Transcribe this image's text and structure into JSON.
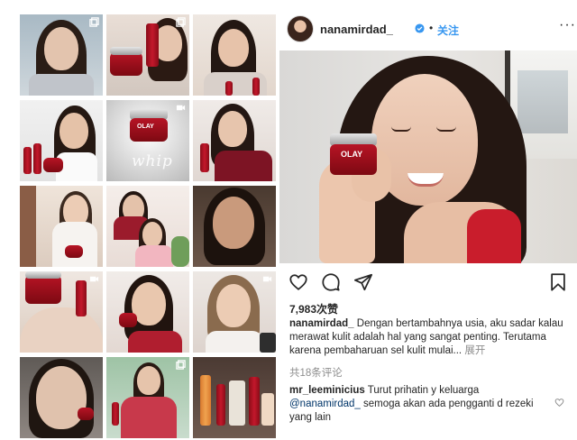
{
  "profile": {
    "username": "nanamirdad_",
    "separator": "•",
    "follow_label": "关注",
    "more_label": "···"
  },
  "post": {
    "likes": "7,983次赞",
    "caption_user": "nanamirdad_",
    "caption_text": " Dengan bertambahnya usia, aku sadar kalau merawat kulit adalah hal yang sangat penting. Terutama karena pembaharuan sel kulit mulai...",
    "caption_more": " 展开",
    "comments_count": "共18条评论",
    "comment": {
      "user": "mr_leeminicius",
      "text_1": " Turut prihatin y keluarga ",
      "mention": "@nanamirdad_",
      "text_2": " semoga akan ada pengganti d rezeki yang lain"
    }
  },
  "grid": {
    "whip_caption": "whip",
    "olay_label": "OLAY"
  },
  "colors": {
    "accent_blue": "#3897f0",
    "olay_red": "#b71425",
    "text": "#262626",
    "muted": "#8e8e8e"
  },
  "icons": [
    "heart-icon",
    "comment-icon",
    "share-icon",
    "bookmark-icon",
    "verified-icon",
    "carousel-icon",
    "video-icon"
  ]
}
